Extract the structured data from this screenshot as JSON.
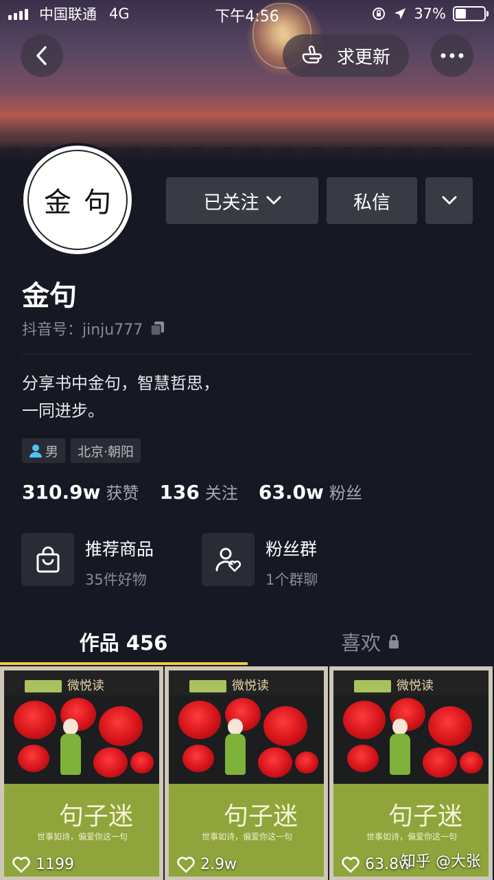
{
  "status_bar": {
    "carrier": "中国联通",
    "network": "4G",
    "time": "下午4:56",
    "battery": "37%",
    "battery_level": 0.37
  },
  "header": {
    "request_update_label": "求更新"
  },
  "profile": {
    "avatar_text": "金句",
    "name": "金句",
    "douyin_id_label": "抖音号：",
    "douyin_id": "jinju777",
    "bio_line1": "分享书中金句，智慧哲思，",
    "bio_line2": "一同进步。",
    "gender": "男",
    "location": "北京·朝阳"
  },
  "actions": {
    "follow_label": "已关注",
    "message_label": "私信"
  },
  "stats": [
    {
      "num": "310.9w",
      "label": "获赞"
    },
    {
      "num": "136",
      "label": "关注"
    },
    {
      "num": "63.0w",
      "label": "粉丝"
    }
  ],
  "features": {
    "shop_title": "推荐商品",
    "shop_sub": "35件好物",
    "fans_title": "粉丝群",
    "fans_sub": "1个群聊"
  },
  "tabs": {
    "works_label": "作品 456",
    "likes_label": "喜欢"
  },
  "videos": [
    {
      "likes": "1199",
      "cover_brand": "微悦读",
      "cover_title": "句子迷",
      "cover_subtitle": "世事如诗，偏爱你这一句"
    },
    {
      "likes": "2.9w",
      "cover_brand": "微悦读",
      "cover_title": "句子迷",
      "cover_subtitle": "世事如诗，偏爱你这一句"
    },
    {
      "likes": "63.8w",
      "cover_brand": "微悦读",
      "cover_title": "句子迷",
      "cover_subtitle": "世事如诗，偏爱你这一句"
    }
  ],
  "watermark": "知乎 @大张",
  "colors": {
    "background": "#161823",
    "accent": "#facc3c",
    "button": "#393b44"
  }
}
